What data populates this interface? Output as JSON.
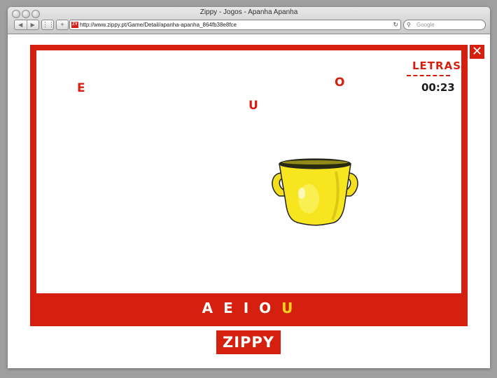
{
  "browser": {
    "title": "Zippy - Jogos - Apanha Apanha",
    "favicon_text": "ZY",
    "url": "http://www.zippy.pt/Game/Detail/apanha-apanha_864fb38e8fce",
    "search_placeholder": "Google",
    "back_label": "◀",
    "forward_label": "▶",
    "reload_label": "↻",
    "add_label": "+",
    "grid_label": "⋮⋮⋮"
  },
  "game": {
    "close_label": "✕",
    "score_title": "LETRAS",
    "timer": "00:23",
    "falling_letters": [
      {
        "letter": "E"
      },
      {
        "letter": "O"
      },
      {
        "letter": "U"
      }
    ],
    "collected_letters": [
      {
        "letter": "A",
        "color": "#ffffff"
      },
      {
        "letter": "E",
        "color": "#ffffff"
      },
      {
        "letter": "I",
        "color": "#ffffff"
      },
      {
        "letter": "O",
        "color": "#ffffff"
      },
      {
        "letter": "U",
        "color": "#f6d21a"
      }
    ],
    "accent_color": "#d6200f"
  },
  "footer": {
    "logo_text": "ZIPPY"
  }
}
